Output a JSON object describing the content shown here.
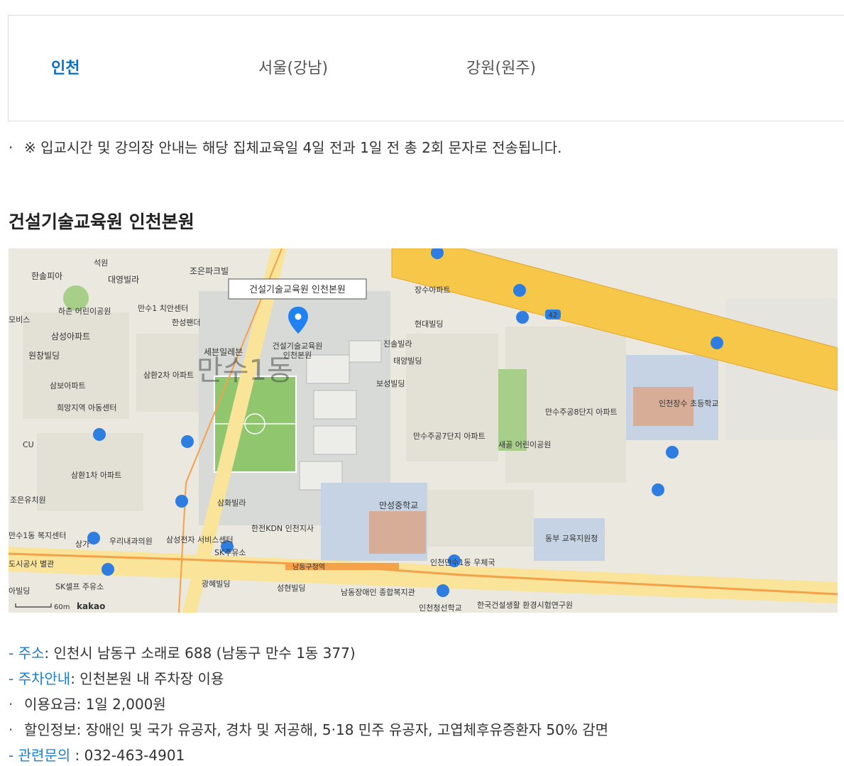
{
  "tabs": [
    {
      "label": "인천",
      "active": true
    },
    {
      "label": "서울(강남)",
      "active": false
    },
    {
      "label": "강원(원주)",
      "active": false
    }
  ],
  "notice": {
    "bullet": "·",
    "text": "※ 입교시간 및 강의장 안내는 해당 집체교육일 4일 전과 1일 전 총 2회 문자로 전송됩니다."
  },
  "section_title": "건설기술교육원 인천본원",
  "map": {
    "marker_label": "건설기술교육원 인천본원",
    "campus_label_line1": "건설기술교육원",
    "campus_label_line2": "인천본원",
    "district_watermark": "만수1동",
    "scale_label": "60m",
    "brand": "kakao",
    "road_badge": "42",
    "station_label": "남동구청역",
    "labels": [
      "한솔피아",
      "석원",
      "대영빌라",
      "조은파크빌",
      "하촌 어린이공원",
      "만수1 치안센터",
      "한성팬더",
      "삼성아파트",
      "원창빌딩",
      "세븐일레븐",
      "삼환2차 아파트",
      "삼보아파트",
      "희망지역 아동센터",
      "CU",
      "삼환1차 아파트",
      "조은유치원",
      "상가",
      "우리내과의원",
      "삼성전자 서비스센터",
      "SK주유소",
      "한전KDN 인천지사",
      "삼화빌라",
      "광혜빌딩",
      "성현빌딩",
      "남동장애인 종합복지관",
      "SK셀프 주유소",
      "장수아파트",
      "현대빌딩",
      "진솔빌라",
      "태양빌딩",
      "보성빌딩",
      "만수주공7단지 아파트",
      "새골 어린이공원",
      "만수주공8단지 아파트",
      "인천장수 초등학교",
      "만성중학교",
      "동부 교육지원청",
      "인천만수1동 우체국",
      "한국건설생활 환경시험연구원",
      "인천청선학교",
      "만수주공",
      "모비스",
      "도시공사 별관",
      "아빌딩",
      "만수1동 복지센터"
    ]
  },
  "info": {
    "address_key": "- 주소",
    "address_value": ": 인천시 남동구 소래로 688 (남동구 만수 1동 377)",
    "parking_key": "- 주차안내",
    "parking_value": ": 인천본원 내 주차장 이용",
    "fee_bullet": "·",
    "fee_text": "이용요금: 1일 2,000원",
    "discount_bullet": "·",
    "discount_text": "할인정보: 장애인 및 국가 유공자, 경차 및 저공해, 5·18 민주 유공자, 고엽체후유증환자 50% 감면",
    "contact_key": "- 관련문의",
    "contact_value": " : 032-463-4901"
  }
}
